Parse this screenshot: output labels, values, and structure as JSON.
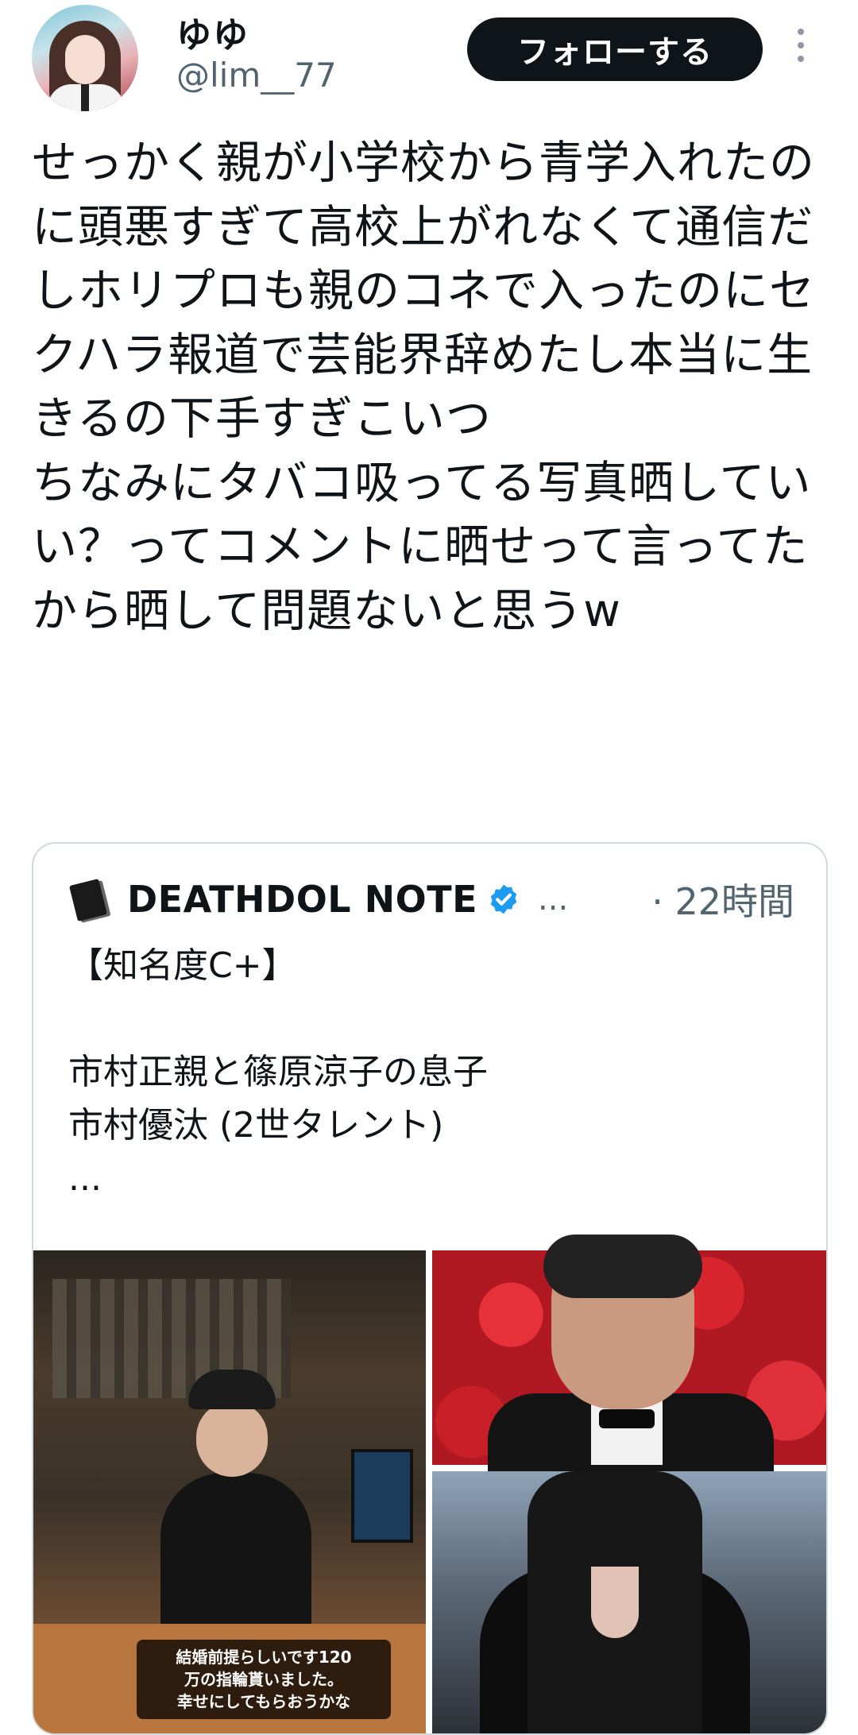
{
  "author": {
    "display_name": "ゆゆ",
    "handle": "@lim__77",
    "follow_label": "フォローする"
  },
  "tweet": {
    "text": "せっかく親が小学校から青学入れたのに頭悪すぎて高校上がれなくて通信だしホリプロも親のコネで入ったのにセクハラ報道で芸能界辞めたし本当に生きるの下手すぎこいつ\nちなみにタバコ吸ってる写真晒していい？ってコメントに晒せって言ってたから晒して問題ないと思うw"
  },
  "quoted": {
    "name": "DEATHDOL NOTE",
    "ellipsis": "...",
    "time": "· 22時間",
    "text": "【知名度C+】\n\n市村正親と篠原涼子の息子\n市村優汰 (2世タレント)\n...",
    "media_caption": "結婚前提らしいです120\n万の指輪貰いました。\n幸せにしてもらおうかな"
  },
  "colors": {
    "verified": "#1d9bf0",
    "button_bg": "#0f1419",
    "muted": "#536471"
  },
  "icons": [
    "avatar",
    "more-icon",
    "note-icon",
    "verified-icon"
  ]
}
